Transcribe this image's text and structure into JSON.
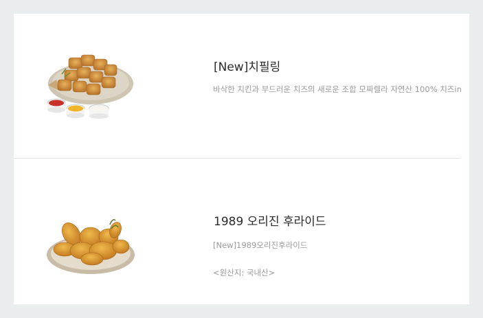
{
  "menu": {
    "items": [
      {
        "name": "[New]치필링",
        "description": "바삭한 치킨과 부드러운 치즈의 새로운 조합 모짜렐라 자연산 100% 치즈in",
        "image": "cheese-nugget-dish"
      },
      {
        "name": "1989 오리진 후라이드",
        "description": "[New]1989오리진후라이드",
        "origin": "<원산지: 국내산>",
        "image": "fried-chicken-plate"
      }
    ]
  },
  "colors": {
    "page_background": "#e9edee",
    "card_background": "#ffffff",
    "title_text": "#2a2a2a",
    "description_text": "#9a9a9a",
    "divider": "#e4e7e8"
  }
}
